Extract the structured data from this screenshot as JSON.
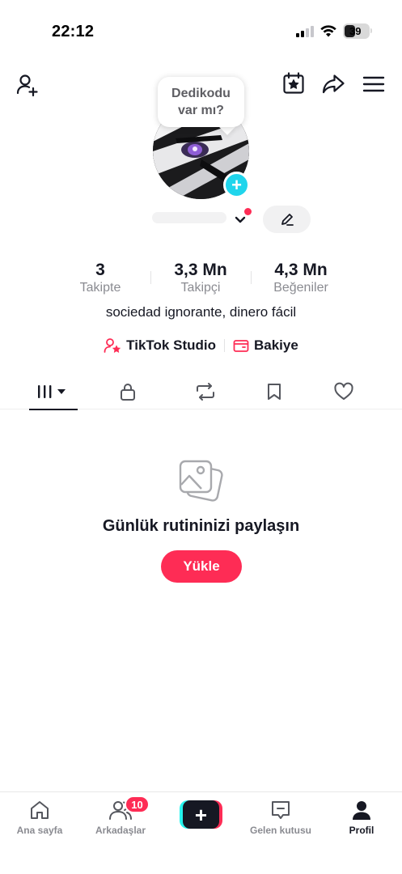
{
  "status_bar": {
    "time": "22:12",
    "battery": "39"
  },
  "profile": {
    "note_bubble": "Dedikodu var mı?",
    "bio": "sociedad ignorante, dinero fácil",
    "stats": [
      {
        "value": "3",
        "label": "Takipte"
      },
      {
        "value": "3,3 Mn",
        "label": "Takipçi"
      },
      {
        "value": "4,3 Mn",
        "label": "Beğeniler"
      }
    ],
    "links": {
      "studio": "TikTok Studio",
      "balance": "Bakiye"
    }
  },
  "empty_state": {
    "title": "Günlük rutininizi paylaşın",
    "button": "Yükle"
  },
  "bottom_nav": {
    "home": "Ana sayfa",
    "friends": "Arkadaşlar",
    "friends_badge": "10",
    "inbox": "Gelen kutusu",
    "profile": "Profil"
  },
  "colors": {
    "accent": "#fe2c55",
    "cyan": "#20d5ec",
    "text": "#161823",
    "muted": "#8a8b91"
  },
  "icons": [
    "add-friend-icon",
    "calendar-star-icon",
    "share-icon",
    "menu-icon",
    "chevron-down-icon",
    "pencil-icon",
    "studio-icon",
    "wallet-icon",
    "grid-icon",
    "lock-icon",
    "repost-icon",
    "bookmark-icon",
    "heart-icon",
    "photos-icon",
    "home-icon",
    "friends-icon",
    "plus-icon",
    "inbox-icon",
    "profile-icon"
  ]
}
